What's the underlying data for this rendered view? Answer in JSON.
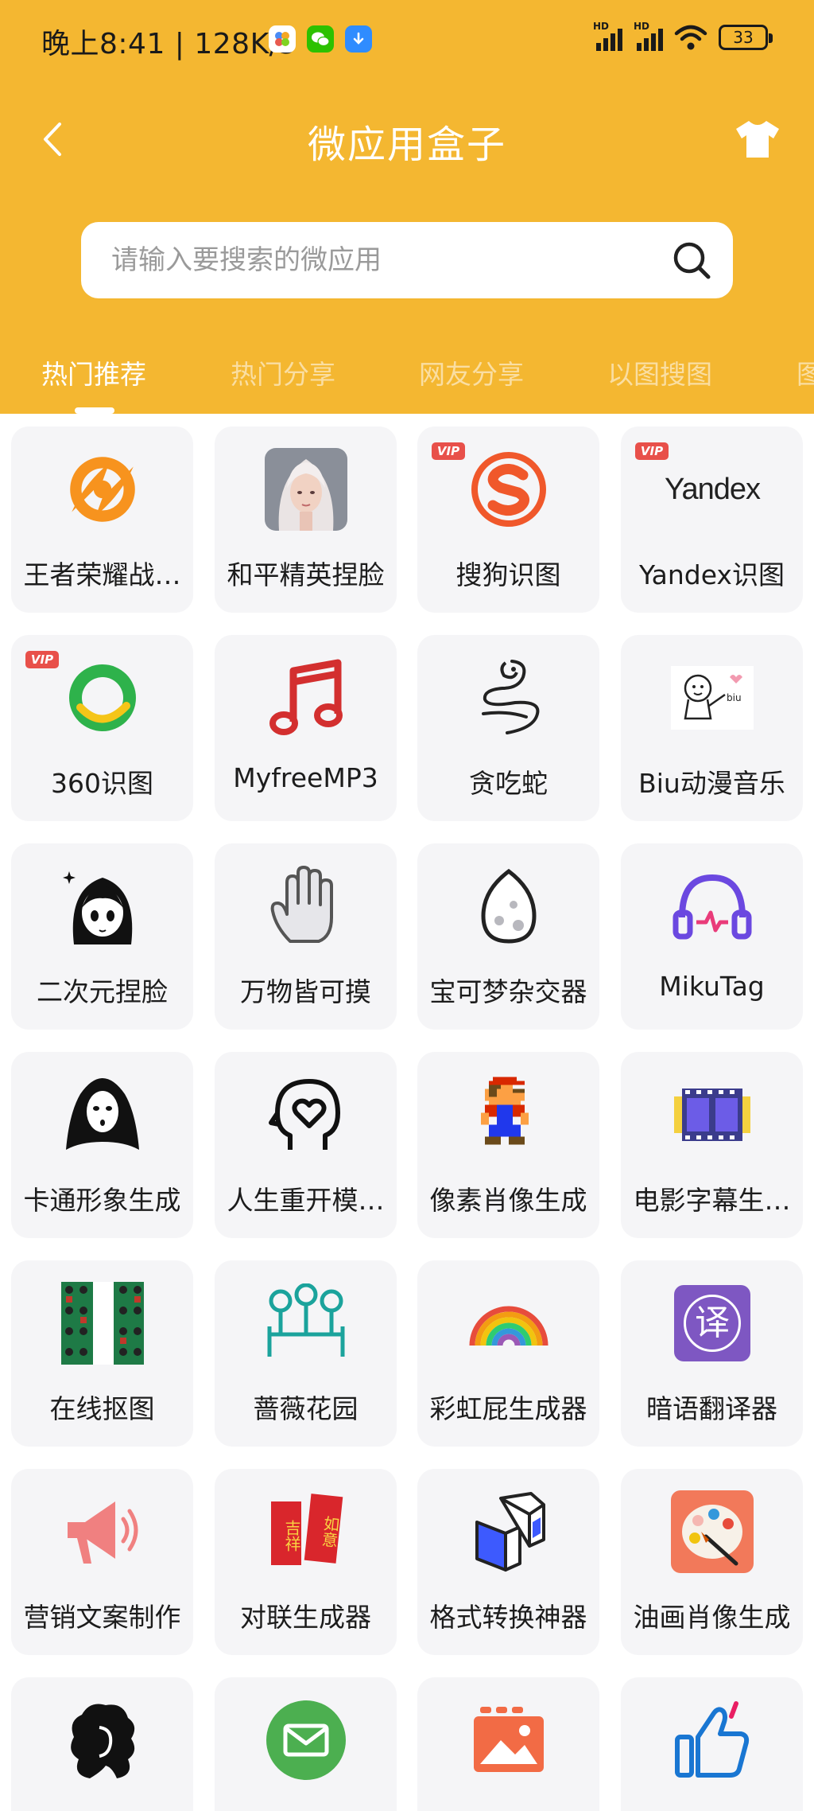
{
  "status_bar": {
    "time": "晚上8:41 | 128K/s",
    "battery": "33",
    "signal_1": "HD",
    "signal_2": "HD"
  },
  "nav": {
    "title": "微应用盒子"
  },
  "search": {
    "placeholder": "请输入要搜索的微应用",
    "value": ""
  },
  "tabs": [
    {
      "label": "热门推荐",
      "active": true
    },
    {
      "label": "热门分享",
      "active": false
    },
    {
      "label": "网友分享",
      "active": false
    },
    {
      "label": "以图搜图",
      "active": false
    },
    {
      "label": "图",
      "active": false
    }
  ],
  "apps": [
    {
      "label": "王者荣耀战…",
      "icon": "game-logo-icon",
      "vip": false
    },
    {
      "label": "和平精英捏脸",
      "icon": "character-face-icon",
      "vip": false
    },
    {
      "label": "搜狗识图",
      "icon": "sogou-icon",
      "vip": true
    },
    {
      "label": "Yandex识图",
      "icon": "yandex-icon",
      "vip": true,
      "icon_text": "Yandex"
    },
    {
      "label": "360识图",
      "icon": "ring-360-icon",
      "vip": true
    },
    {
      "label": "MyfreeMP3",
      "icon": "music-note-icon",
      "vip": false
    },
    {
      "label": "贪吃蛇",
      "icon": "snake-icon",
      "vip": false
    },
    {
      "label": "Biu动漫音乐",
      "icon": "cartoon-biu-icon",
      "vip": false,
      "icon_text": "biu"
    },
    {
      "label": "二次元捏脸",
      "icon": "anime-girl-icon",
      "vip": false
    },
    {
      "label": "万物皆可摸",
      "icon": "hand-icon",
      "vip": false
    },
    {
      "label": "宝可梦杂交器",
      "icon": "egg-icon",
      "vip": false
    },
    {
      "label": "MikuTag",
      "icon": "headphones-icon",
      "vip": false
    },
    {
      "label": "卡通形象生成",
      "icon": "ghost-mask-icon",
      "vip": false
    },
    {
      "label": "人生重开模…",
      "icon": "head-heart-icon",
      "vip": false
    },
    {
      "label": "像素肖像生成",
      "icon": "pixel-character-icon",
      "vip": false
    },
    {
      "label": "电影字幕生…",
      "icon": "film-strip-icon",
      "vip": false
    },
    {
      "label": "在线抠图",
      "icon": "photo-grid-icon",
      "vip": false
    },
    {
      "label": "蔷薇花园",
      "icon": "garden-icon",
      "vip": false
    },
    {
      "label": "彩虹屁生成器",
      "icon": "rainbow-icon",
      "vip": false
    },
    {
      "label": "暗语翻译器",
      "icon": "translate-icon",
      "vip": false,
      "icon_text": "译"
    },
    {
      "label": "营销文案制作",
      "icon": "megaphone-icon",
      "vip": false
    },
    {
      "label": "对联生成器",
      "icon": "couplet-icon",
      "vip": false,
      "icon_text_left": "吉祥",
      "icon_text_right": "如意"
    },
    {
      "label": "格式转换神器",
      "icon": "format-convert-icon",
      "vip": false
    },
    {
      "label": "油画肖像生成",
      "icon": "palette-icon",
      "vip": false
    },
    {
      "label": "",
      "icon": "silhouette-icon",
      "vip": false
    },
    {
      "label": "",
      "icon": "mail-icon",
      "vip": false
    },
    {
      "label": "",
      "icon": "image-icon",
      "vip": false
    },
    {
      "label": "",
      "icon": "thumbs-up-icon",
      "vip": false
    }
  ],
  "colors": {
    "header": "#F4B731",
    "card": "#F5F5F7",
    "vip": "#E8504A"
  }
}
